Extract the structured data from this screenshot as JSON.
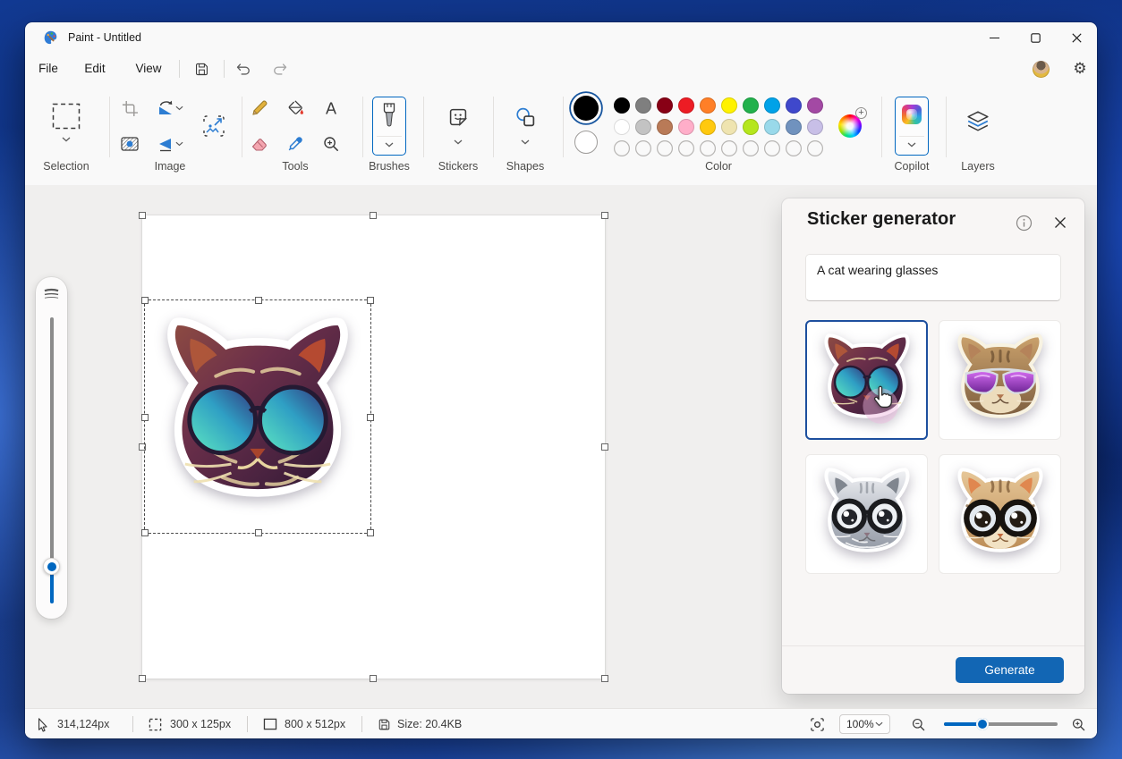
{
  "window": {
    "title": "Paint - Untitled"
  },
  "menu": {
    "file": "File",
    "edit": "Edit",
    "view": "View"
  },
  "ribbon": {
    "selection_label": "Selection",
    "image_label": "Image",
    "tools_label": "Tools",
    "brushes_label": "Brushes",
    "stickers_label": "Stickers",
    "shapes_label": "Shapes",
    "color_label": "Color",
    "copilot_label": "Copilot",
    "layers_label": "Layers",
    "text_tool_glyph": "A",
    "color1": "#000000",
    "color2": "#ffffff",
    "palette_row1": [
      "#000000",
      "#7f7f7f",
      "#880015",
      "#ed1c24",
      "#ff7f27",
      "#fff200",
      "#22b14c",
      "#00a2e8",
      "#3f48cc",
      "#a349a4"
    ],
    "palette_row2": [
      "#ffffff",
      "#c3c3c3",
      "#b97a57",
      "#ffaec9",
      "#ffc90e",
      "#efe4b0",
      "#b5e61d",
      "#99d9ea",
      "#7092be",
      "#c8bfe7"
    ],
    "empty_slots": 10
  },
  "panel": {
    "title": "Sticker generator",
    "prompt": "A cat wearing glasses",
    "generate_label": "Generate",
    "stickers": [
      {
        "name": "stylized dark purple cat with teal round sunglasses",
        "selected": true
      },
      {
        "name": "tabby cat with purple aviator sunglasses",
        "selected": false
      },
      {
        "name": "gray cat with black eyeglasses",
        "selected": false
      },
      {
        "name": "cartoon kitten with big round glasses",
        "selected": false
      }
    ]
  },
  "status": {
    "cursor_position": "314,124px",
    "selection_size": "300 x 125px",
    "canvas_size": "800 x 512px",
    "file_size": "Size: 20.4KB",
    "zoom_value": "100%"
  },
  "colors": {
    "accent": "#0067c0",
    "generate_button": "#1266b4",
    "selected_card_border": "#1d4f9e"
  }
}
